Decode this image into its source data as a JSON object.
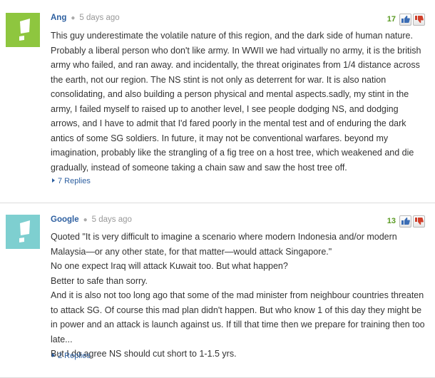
{
  "colors": {
    "avatar_green": "#8ec63f",
    "avatar_teal": "#7ecfd0",
    "link": "#2d5fa0",
    "vote_count": "#5a9a22",
    "thumbs_down": "#d0402b"
  },
  "comments": [
    {
      "author": "Ang",
      "time": "5 days ago",
      "votes": "17",
      "body": "This guy underestimate the volatile nature of this region, and the dark side of human nature. Probably a liberal person who don't like army. In WWII we had virtually no army, it is the british army who failed, and ran away. and incidentally, the threat originates from 1/4 distance across the earth, not our region. The NS stint is not only as deterrent for war. It is also nation consolidating, and also building a person physical and mental aspects.sadly, my stint in the army, I failed myself to raised up to another level, I see people dodging NS, and dodging arrows, and I have to admit that I'd fared poorly in the mental test and of enduring the dark antics of some SG soldiers. In future, it may not be conventional warfares. beyond my imagination, probably like the strangling of a fig tree on a host tree, which weakened and die gradually, instead of someone taking a chain saw and saw the host tree off.",
      "replies": "7 Replies"
    },
    {
      "author": "Google",
      "time": "5 days ago",
      "votes": "13",
      "body_lines": [
        "Quoted \"It is very difficult to imagine a scenario where modern Indonesia and/or modern Malaysia—or any other state, for that matter—would attack Singapore.\"",
        "No one expect Iraq will attack Kuwait too. But what happen?",
        "Better to safe than sorry.",
        "And it is also not too long ago that some of the mad minister from neighbour countries threaten to attack SG. Of course this mad plan didn't happen. But who know 1 of this day they might be in power and an attack is launch against us. If till that time then we prepare for training then too late...",
        "But I do agree NS should cut short to 1-1.5 yrs."
      ],
      "replies": "2 Replies"
    }
  ]
}
